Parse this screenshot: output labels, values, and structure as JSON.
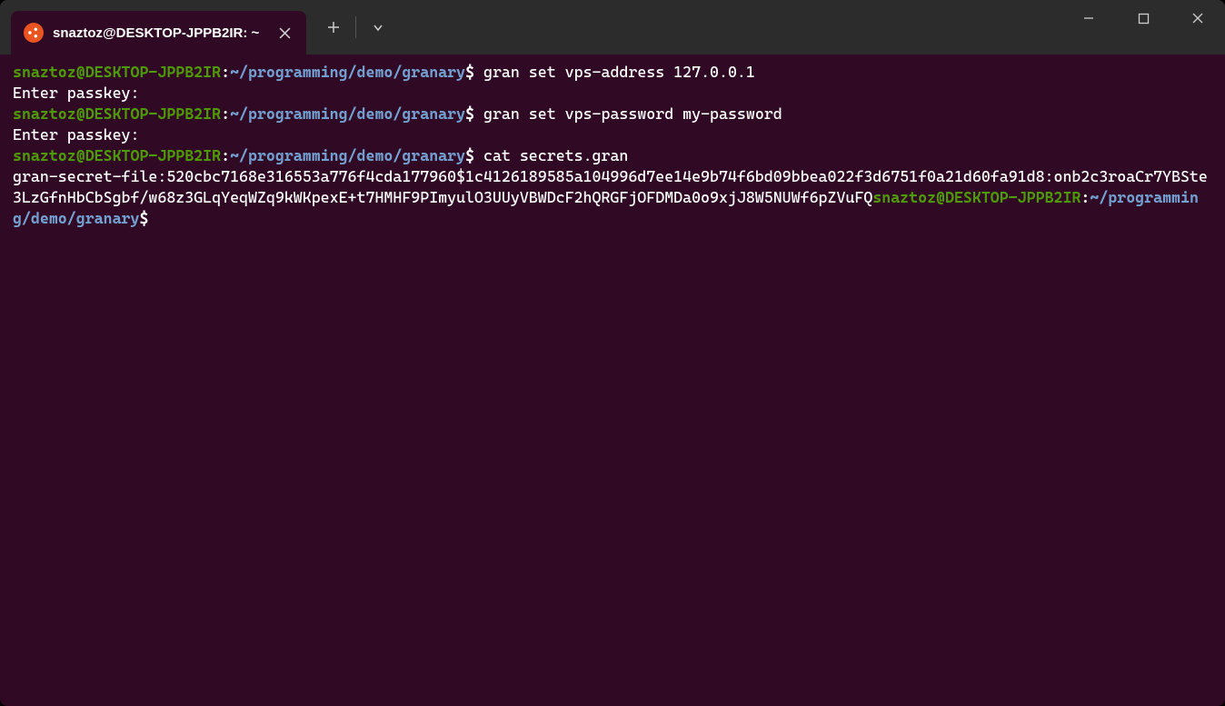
{
  "titlebar": {
    "tab_title": "snaztoz@DESKTOP-JPPB2IR: ~"
  },
  "prompt": {
    "user_host": "snaztoz@DESKTOP-JPPB2IR",
    "path": "~/programming/demo/granary",
    "symbol": "$"
  },
  "lines": {
    "cmd1": "gran set vps-address 127.0.0.1",
    "out1": "Enter passkey:",
    "cmd2": "gran set vps-password my-password",
    "out2": "Enter passkey:",
    "cmd3": "cat secrets.gran",
    "out3a": "gran-secret-file:520cbc7168e316553a776f4cda177960$1c4126189585a104996d7ee14e9b74f6bd09bbea022f3d6751f0a21d60fa91d8:onb2c3roaCr7YBSte3LzGfnHbCbSgbf/w68z3GLqYeqWZq9kWKpexE+t7HMHF9PImyulO3UUyVBWDcF2hQRGFjOFDMDa0o9xjJ8W5NUWf6pZVuFQ"
  }
}
